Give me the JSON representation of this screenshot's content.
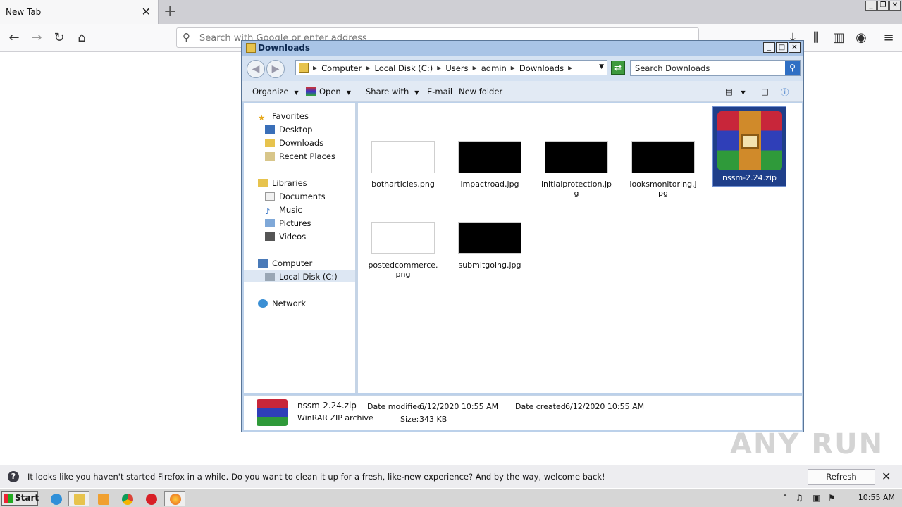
{
  "firefox": {
    "tab_title": "New Tab",
    "url_placeholder": "Search with Google or enter address"
  },
  "notification": {
    "message": "It looks like you haven't started Firefox in a while. Do you want to clean it up for a fresh, like-new experience? And by the way, welcome back!",
    "button": "Refresh Firefox…"
  },
  "explorer": {
    "title": "Downloads",
    "breadcrumb": [
      "Computer",
      "Local Disk (C:)",
      "Users",
      "admin",
      "Downloads"
    ],
    "search_placeholder": "Search Downloads",
    "toolbar": {
      "organize": "Organize",
      "open": "Open",
      "share_with": "Share with",
      "email": "E-mail",
      "new_folder": "New folder"
    },
    "nav": {
      "favorites": "Favorites",
      "desktop": "Desktop",
      "downloads": "Downloads",
      "recent_places": "Recent Places",
      "libraries": "Libraries",
      "documents": "Documents",
      "music": "Music",
      "pictures": "Pictures",
      "videos": "Videos",
      "computer": "Computer",
      "local_disk": "Local Disk (C:)",
      "network": "Network"
    },
    "files": [
      {
        "name": "botharticles.png",
        "thumb_color": "#ffffff"
      },
      {
        "name": "impactroad.jpg",
        "thumb_color": "#000000"
      },
      {
        "name": "initialprotection.jpg",
        "thumb_color": "#000000"
      },
      {
        "name": "looksmonitoring.jpg",
        "thumb_color": "#000000"
      },
      {
        "name": "nssm-2.24.zip",
        "thumb_color": "#1f3f8a",
        "selected": true
      },
      {
        "name": "postedcommerce.png",
        "thumb_color": "#ffffff"
      },
      {
        "name": "submitgoing.jpg",
        "thumb_color": "#000000"
      }
    ],
    "details": {
      "name": "nssm-2.24.zip",
      "type": "WinRAR ZIP archive",
      "date_modified_label": "Date modified:",
      "date_modified": "6/12/2020 10:55 AM",
      "size_label": "Size:",
      "size": "343 KB",
      "date_created_label": "Date created:",
      "date_created": "6/12/2020 10:55 AM"
    }
  },
  "taskbar": {
    "start": "Start",
    "clock": "10:55 AM"
  },
  "watermark": "ANY RUN"
}
